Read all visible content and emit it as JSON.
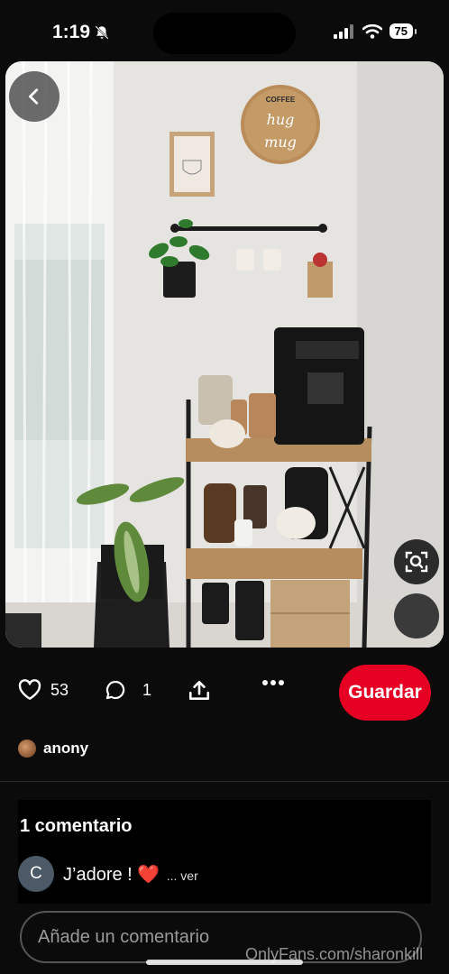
{
  "status_bar": {
    "time": "1:19",
    "battery": "75"
  },
  "pin": {
    "likes": "53",
    "comments": "1",
    "save_label": "Guardar",
    "author": "anony",
    "sign_text": "COFFEE IS A hug IN A mug"
  },
  "comments_section": {
    "title": "1 comentario",
    "items": [
      {
        "avatar_letter": "C",
        "text": "J’adore ! ",
        "emoji": "❤️",
        "more": "... ver"
      }
    ]
  },
  "comment_input": {
    "placeholder": "Añade un comentario"
  },
  "watermark": "OnlyFans.com/sharonkill",
  "colors": {
    "accent": "#e60023",
    "background": "#0b0b0b"
  },
  "icons": [
    "back-icon",
    "heart-icon",
    "comment-icon",
    "share-icon",
    "more-icon",
    "visual-search-icon",
    "bell-slash-icon",
    "signal-icon",
    "wifi-icon"
  ]
}
